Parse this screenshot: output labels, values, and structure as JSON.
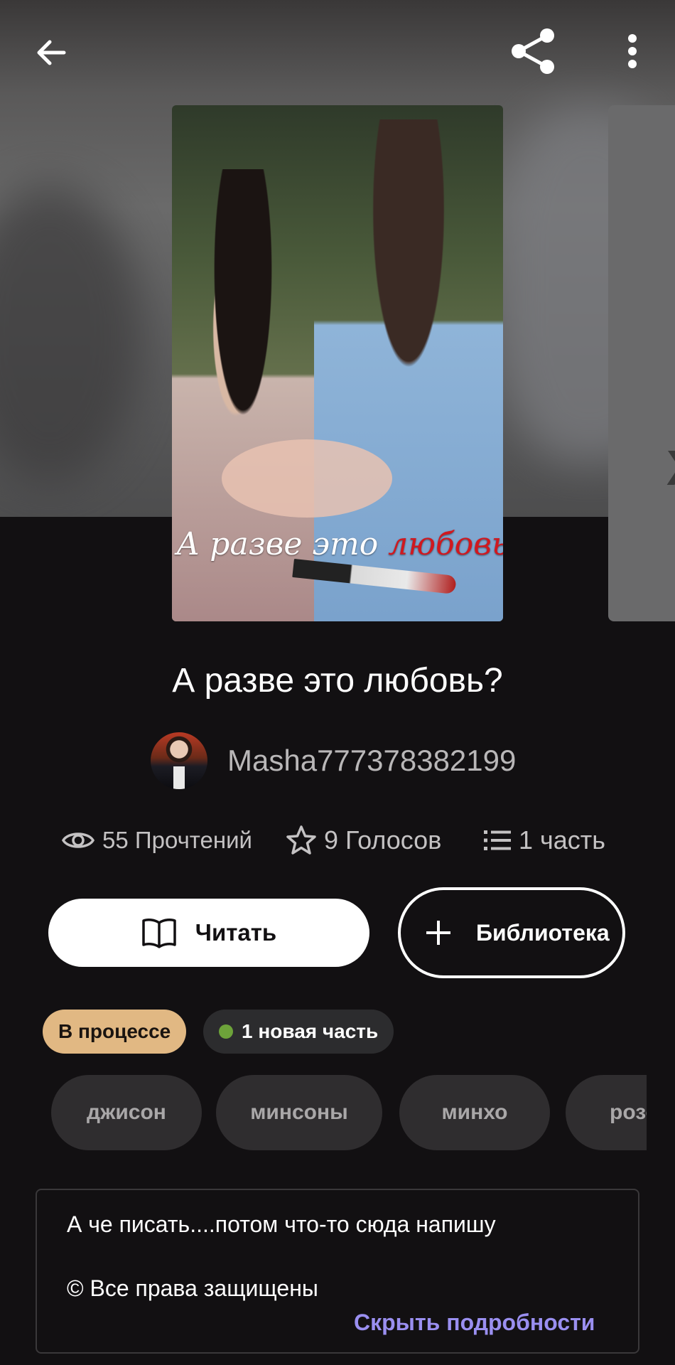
{
  "header": {
    "back_icon": "arrow-left-icon",
    "share_icon": "share-icon",
    "more_icon": "more-vertical-icon"
  },
  "cover": {
    "text_part1": "А разве это ",
    "text_part2": "любовь?"
  },
  "story": {
    "title": "А разве это любовь?",
    "author": "Masha777378382199"
  },
  "stats": {
    "reads": "55 Прочтений",
    "votes": "9 Голосов",
    "parts": "1 часть"
  },
  "actions": {
    "read_label": "Читать",
    "library_label": "Библиотека"
  },
  "badges": {
    "status": "В процессе",
    "new_parts": "1 новая часть"
  },
  "tags": [
    "джисон",
    "минсоны",
    "минхо",
    "розовое"
  ],
  "description": {
    "text": "А че писать....потом что-то сюда напишу",
    "copyright": "© Все права защищены",
    "hide_label": "Скрыть подробности"
  },
  "colors": {
    "background": "#121012",
    "status_badge": "#e1b883",
    "new_dot": "#6da33a",
    "link": "#9a8ff0"
  }
}
